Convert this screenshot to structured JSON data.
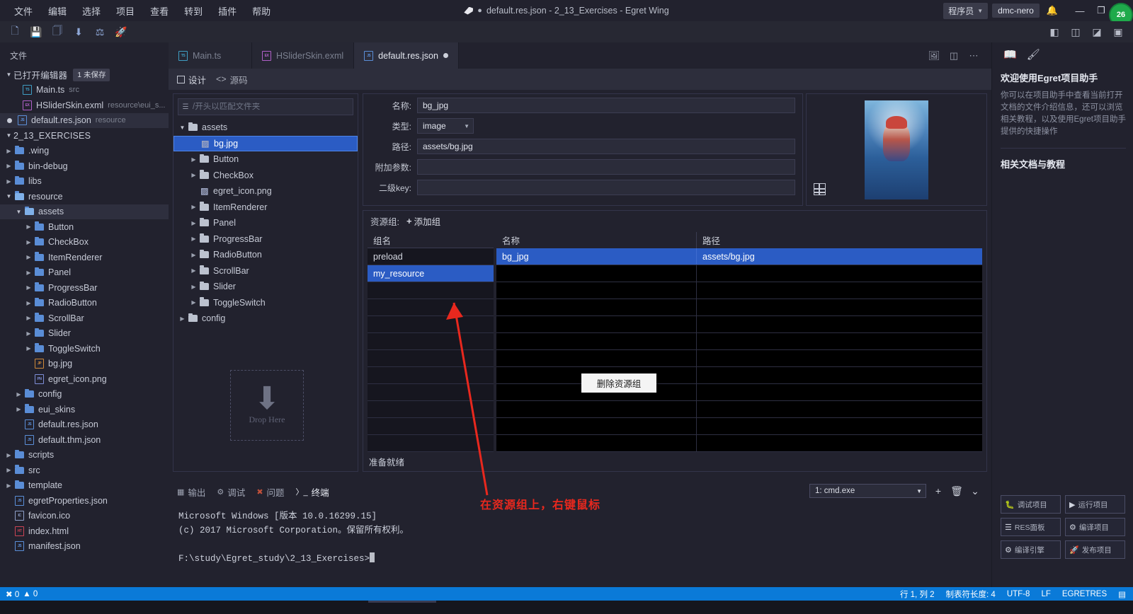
{
  "window": {
    "title": "default.res.json - 2_13_Exercises - Egret Wing",
    "dirty_marker": "●",
    "menus": [
      "文件",
      "编辑",
      "选择",
      "项目",
      "查看",
      "转到",
      "插件",
      "帮助"
    ],
    "role_chip": "程序员",
    "user_chip": "dmc-nero",
    "badge": "26",
    "min_label": "—",
    "max_label": "❐",
    "close_label": "✕"
  },
  "toolbar": {
    "left_icons": [
      "new-file-icon",
      "save-icon",
      "save-all-icon",
      "import-icon",
      "build-icon",
      "publish-icon"
    ],
    "right_icons": [
      "layout-sidebar-icon",
      "layout-panel-icon",
      "layout-right-icon",
      "layout-full-icon"
    ]
  },
  "explorer": {
    "title": "文件",
    "open_editors": {
      "label": "已打开编辑器",
      "badge": "1 未保存",
      "files": [
        {
          "name": "Main.ts",
          "sub": "src",
          "icon": "ts-file-icon",
          "dirty": false
        },
        {
          "name": "HSliderSkin.exml",
          "sub": "resource\\eui_s...",
          "icon": "exml-file-icon",
          "dirty": false
        },
        {
          "name": "default.res.json",
          "sub": "resource",
          "icon": "json-file-icon",
          "dirty": true
        }
      ]
    },
    "project": {
      "name": "2_13_EXERCISES",
      "nodes": [
        {
          "label": ".wing",
          "type": "folder",
          "depth": 1,
          "expanded": false
        },
        {
          "label": "bin-debug",
          "type": "folder",
          "depth": 1,
          "expanded": false
        },
        {
          "label": "libs",
          "type": "folder",
          "depth": 1,
          "expanded": false
        },
        {
          "label": "resource",
          "type": "folder",
          "depth": 1,
          "expanded": true
        },
        {
          "label": "assets",
          "type": "folder",
          "depth": 2,
          "expanded": true,
          "selected": true
        },
        {
          "label": "Button",
          "type": "folder",
          "depth": 3,
          "expanded": false
        },
        {
          "label": "CheckBox",
          "type": "folder",
          "depth": 3,
          "expanded": false
        },
        {
          "label": "ItemRenderer",
          "type": "folder",
          "depth": 3,
          "expanded": false
        },
        {
          "label": "Panel",
          "type": "folder",
          "depth": 3,
          "expanded": false
        },
        {
          "label": "ProgressBar",
          "type": "folder",
          "depth": 3,
          "expanded": false
        },
        {
          "label": "RadioButton",
          "type": "folder",
          "depth": 3,
          "expanded": false
        },
        {
          "label": "ScrollBar",
          "type": "folder",
          "depth": 3,
          "expanded": false
        },
        {
          "label": "Slider",
          "type": "folder",
          "depth": 3,
          "expanded": false
        },
        {
          "label": "ToggleSwitch",
          "type": "folder",
          "depth": 3,
          "expanded": false
        },
        {
          "label": "bg.jpg",
          "type": "jpg",
          "depth": 3
        },
        {
          "label": "egret_icon.png",
          "type": "png",
          "depth": 3
        },
        {
          "label": "config",
          "type": "folder",
          "depth": 2,
          "expanded": false
        },
        {
          "label": "eui_skins",
          "type": "folder",
          "depth": 2,
          "expanded": false
        },
        {
          "label": "default.res.json",
          "type": "json",
          "depth": 2
        },
        {
          "label": "default.thm.json",
          "type": "json",
          "depth": 2
        },
        {
          "label": "scripts",
          "type": "folder",
          "depth": 1,
          "expanded": false
        },
        {
          "label": "src",
          "type": "folder",
          "depth": 1,
          "expanded": false
        },
        {
          "label": "template",
          "type": "folder",
          "depth": 1,
          "expanded": false
        },
        {
          "label": "egretProperties.json",
          "type": "json",
          "depth": 1
        },
        {
          "label": "favicon.ico",
          "type": "ico",
          "depth": 1
        },
        {
          "label": "index.html",
          "type": "html",
          "depth": 1
        },
        {
          "label": "manifest.json",
          "type": "json",
          "depth": 1
        }
      ]
    }
  },
  "tabs": [
    {
      "label": "Main.ts",
      "icon": "ts-file-icon",
      "active": false,
      "dirty": false
    },
    {
      "label": "HSliderSkin.exml",
      "icon": "exml-file-icon",
      "active": false,
      "dirty": false
    },
    {
      "label": "default.res.json",
      "icon": "json-file-icon",
      "active": true,
      "dirty": true
    }
  ],
  "subtabs": [
    {
      "label": "设计",
      "icon": "design-icon",
      "active": true
    },
    {
      "label": "源码",
      "icon": "code-icon",
      "active": false
    }
  ],
  "res_tree": {
    "search_placeholder": "/开头以匹配文件夹",
    "nodes": [
      {
        "label": "assets",
        "type": "folder",
        "depth": 0,
        "expanded": true
      },
      {
        "label": "bg.jpg",
        "type": "image",
        "depth": 1,
        "selected": true
      },
      {
        "label": "Button",
        "type": "folder",
        "depth": 1,
        "expanded": false
      },
      {
        "label": "CheckBox",
        "type": "folder",
        "depth": 1,
        "expanded": false
      },
      {
        "label": "egret_icon.png",
        "type": "image",
        "depth": 1
      },
      {
        "label": "ItemRenderer",
        "type": "folder",
        "depth": 1,
        "expanded": false
      },
      {
        "label": "Panel",
        "type": "folder",
        "depth": 1,
        "expanded": false
      },
      {
        "label": "ProgressBar",
        "type": "folder",
        "depth": 1,
        "expanded": false
      },
      {
        "label": "RadioButton",
        "type": "folder",
        "depth": 1,
        "expanded": false
      },
      {
        "label": "ScrollBar",
        "type": "folder",
        "depth": 1,
        "expanded": false
      },
      {
        "label": "Slider",
        "type": "folder",
        "depth": 1,
        "expanded": false
      },
      {
        "label": "ToggleSwitch",
        "type": "folder",
        "depth": 1,
        "expanded": false
      },
      {
        "label": "config",
        "type": "folder",
        "depth": 0,
        "expanded": false
      }
    ],
    "dropzone_text": "Drop Here"
  },
  "properties": {
    "name_label": "名称:",
    "name_value": "bg_jpg",
    "type_label": "类型:",
    "type_value": "image",
    "path_label": "路径:",
    "path_value": "assets/bg.jpg",
    "extra_label": "附加参数:",
    "extra_value": "",
    "subkey_label": "二级key:",
    "subkey_value": ""
  },
  "groups": {
    "label": "资源组:",
    "add_label": "添加组",
    "col_group": "组名",
    "col_name": "名称",
    "col_path": "路径",
    "rows": [
      {
        "group": "preload",
        "selected": false
      },
      {
        "group": "my_resource",
        "selected": true
      },
      {
        "group": "",
        "selected": false
      },
      {
        "group": "",
        "selected": false
      },
      {
        "group": "",
        "selected": false
      },
      {
        "group": "",
        "selected": false
      },
      {
        "group": "",
        "selected": false
      },
      {
        "group": "",
        "selected": false
      },
      {
        "group": "",
        "selected": false
      },
      {
        "group": "",
        "selected": false
      },
      {
        "group": "",
        "selected": false
      },
      {
        "group": "",
        "selected": false
      }
    ],
    "items": [
      {
        "name": "bg_jpg",
        "path": "assets/bg.jpg",
        "selected": true
      },
      {
        "name": "",
        "path": "",
        "selected": false
      },
      {
        "name": "",
        "path": "",
        "selected": false
      },
      {
        "name": "",
        "path": "",
        "selected": false
      },
      {
        "name": "",
        "path": "",
        "selected": false
      },
      {
        "name": "",
        "path": "",
        "selected": false
      },
      {
        "name": "",
        "path": "",
        "selected": false
      },
      {
        "name": "",
        "path": "",
        "selected": false
      },
      {
        "name": "",
        "path": "",
        "selected": false
      },
      {
        "name": "",
        "path": "",
        "selected": false
      },
      {
        "name": "",
        "path": "",
        "selected": false
      },
      {
        "name": "",
        "path": "",
        "selected": false
      }
    ],
    "status": "准备就绪"
  },
  "context_menu": {
    "items": [
      "删除资源组"
    ]
  },
  "bottom_panel": {
    "tabs": [
      {
        "label": "输出",
        "icon": "output-icon",
        "active": false
      },
      {
        "label": "调试",
        "icon": "debug-icon",
        "active": false
      },
      {
        "label": "问题",
        "icon": "problems-icon",
        "active": false
      },
      {
        "label": "终端",
        "icon": "terminal-icon",
        "active": true
      }
    ],
    "terminal_select": "1: cmd.exe",
    "terminal_actions": [
      "add-terminal-icon",
      "kill-terminal-icon",
      "collapse-panel-icon"
    ],
    "terminal_lines": [
      "Microsoft Windows [版本 10.0.16299.15]",
      "(c) 2017 Microsoft Corporation。保留所有权利。",
      "",
      "F:\\study\\Egret_study\\2_13_Exercises>"
    ]
  },
  "right_panel": {
    "icons": [
      "assistant-icon",
      "brush-icon"
    ],
    "heading": "欢迎使用Egret项目助手",
    "body": "你可以在项目助手中查看当前打开文档的文件介绍信息，还可以浏览相关教程，以及使用Egret项目助手提供的快捷操作",
    "section2": "相关文档与教程",
    "buttons": [
      {
        "label": "调试项目",
        "icon": "bug-icon"
      },
      {
        "label": "运行项目",
        "icon": "play-icon"
      },
      {
        "label": "RES面板",
        "icon": "res-panel-icon"
      },
      {
        "label": "编译项目",
        "icon": "compile-icon"
      },
      {
        "label": "编译引擎",
        "icon": "engine-icon"
      },
      {
        "label": "发布项目",
        "icon": "rocket-icon"
      }
    ]
  },
  "status_bar": {
    "errors": "0",
    "warnings": "0",
    "position": "行 1, 列 2",
    "tab_size": "制表符长度: 4",
    "encoding": "UTF-8",
    "eol": "LF",
    "language": "EGRETRES",
    "notify_icon": "feedback-icon"
  },
  "annotation": {
    "text": "在资源组上，右键鼠标",
    "color": "#e8281e"
  }
}
